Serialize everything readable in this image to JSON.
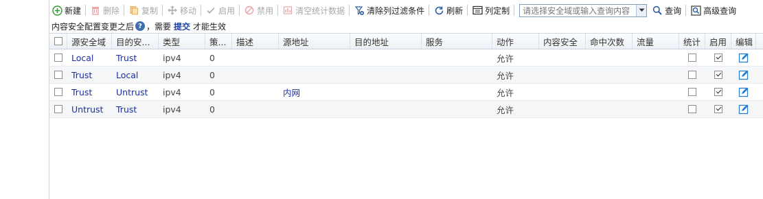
{
  "toolbar": {
    "new_label": "新建",
    "delete_label": "删除",
    "copy_label": "复制",
    "move_label": "移动",
    "enable_label": "启用",
    "disable_label": "禁用",
    "clear_stats_label": "清空统计数据",
    "clear_filter_label": "清除列过滤条件",
    "refresh_label": "刷新",
    "customize_columns_label": "列定制",
    "search_placeholder": "请选择安全域或输入查询内容",
    "query_label": "查询",
    "advanced_query_label": "高级查询"
  },
  "notice": {
    "text_before": "内容安全配置变更之后",
    "help_symbol": "?",
    "text_middle": "，需要",
    "submit_link": "提交",
    "text_after": "才能生效"
  },
  "table": {
    "headers": [
      "源安全域",
      "目的安...",
      "类型",
      "策...",
      "描述",
      "源地址",
      "目的地址",
      "服务",
      "动作",
      "内容安全",
      "命中次数",
      "流量",
      "统计",
      "启用",
      "编辑"
    ],
    "rows": [
      {
        "src_zone": "Local",
        "dst_zone": "Trust",
        "type": "ipv4",
        "policy_id": "0",
        "desc": "",
        "src_addr": "",
        "dst_addr": "",
        "service": "",
        "action": "允许",
        "content_sec": "",
        "hits": "",
        "traffic": "",
        "stats": false,
        "enabled": true
      },
      {
        "src_zone": "Trust",
        "dst_zone": "Local",
        "type": "ipv4",
        "policy_id": "0",
        "desc": "",
        "src_addr": "",
        "dst_addr": "",
        "service": "",
        "action": "允许",
        "content_sec": "",
        "hits": "",
        "traffic": "",
        "stats": false,
        "enabled": true
      },
      {
        "src_zone": "Trust",
        "dst_zone": "Untrust",
        "type": "ipv4",
        "policy_id": "0",
        "desc": "",
        "src_addr": "内网",
        "dst_addr": "",
        "service": "",
        "action": "允许",
        "content_sec": "",
        "hits": "",
        "traffic": "",
        "stats": false,
        "enabled": true
      },
      {
        "src_zone": "Untrust",
        "dst_zone": "Trust",
        "type": "ipv4",
        "policy_id": "0",
        "desc": "",
        "src_addr": "",
        "dst_addr": "",
        "service": "",
        "action": "允许",
        "content_sec": "",
        "hits": "",
        "traffic": "",
        "stats": false,
        "enabled": true
      }
    ]
  },
  "colors": {
    "zone_link": "#1a2ea0",
    "accent_green": "#2e9b2e",
    "accent_blue": "#3f6fb0"
  }
}
